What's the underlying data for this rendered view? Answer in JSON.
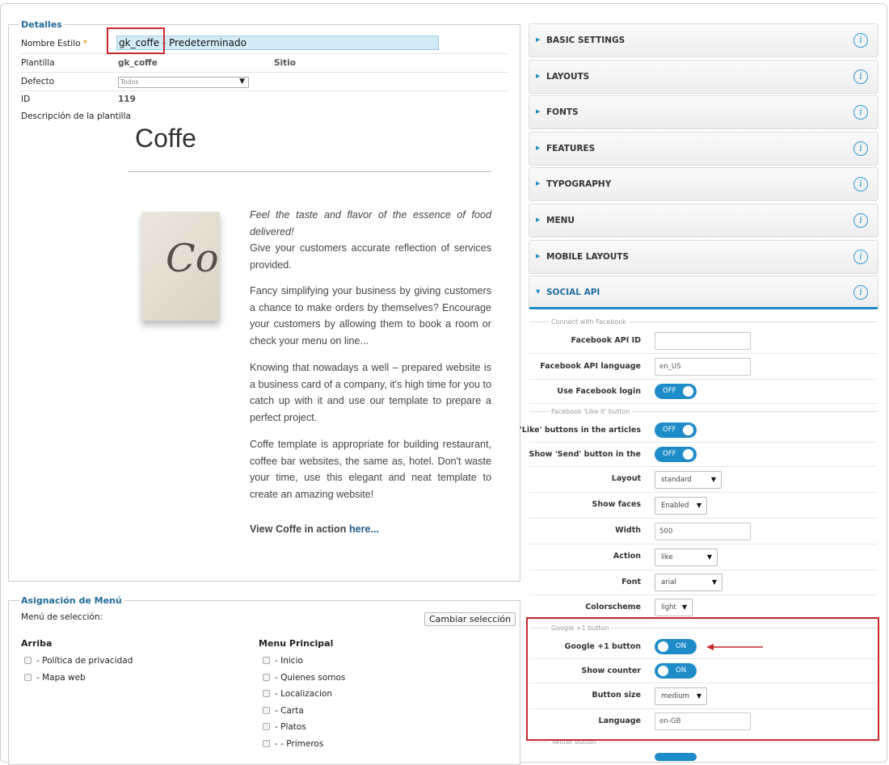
{
  "details": {
    "legend": "Detalles",
    "style_name_label": "Nombre Estilo",
    "required_mark": "*",
    "style_name_value": "gk_coffe - Predeterminado",
    "template_label": "Plantilla",
    "template_value": "gk_coffe",
    "site_label": "Sitio",
    "default_label": "Defecto",
    "default_value": "Todos",
    "id_label": "ID",
    "id_value": "119",
    "description_label": "Descripción de la plantilla"
  },
  "preview": {
    "title": "Coffe",
    "image_text": "Co",
    "p1_italic": "Feel the taste and flavor of the essence of food delivered!",
    "p1_rest": "Give your customers accurate reflection of services provided.",
    "p2": "Fancy simplifying your business by giving customers a chance to make orders by themselves? Encourage your customers by allowing them to book a room or check your menu on line...",
    "p3": "Knowing that nowadays a well – prepared website is a business card of a company, it's high time for you to catch up with it and use our template to prepare a perfect project.",
    "p4": "Coffe template is appropriate for building restaurant, coffee bar websites, the same as, hotel. Don't waste your time, use this elegant and neat template to create an amazing website!",
    "cta_text": "View Coffe in action",
    "cta_link": "here..."
  },
  "menu_assign": {
    "legend": "Asignación de Menú",
    "selection_label": "Menú de selección:",
    "change_button": "Cambiar selección",
    "col1_title": "Arriba",
    "col1_items": [
      "- Política de privacidad",
      "- Mapa web"
    ],
    "col2_title": "Menu Principal",
    "col2_items": [
      "- Inicio",
      "- Quienes somos",
      "- Localizacion",
      "- Carta",
      "- Platos",
      "- - Primeros"
    ]
  },
  "panels": [
    "BASIC SETTINGS",
    "LAYOUTS",
    "FONTS",
    "FEATURES",
    "TYPOGRAPHY",
    "MENU",
    "MOBILE LAYOUTS",
    "SOCIAL API"
  ],
  "info_glyph": "i",
  "social": {
    "sect_facebook": "Connect with Facebook",
    "fb_api_id_label": "Facebook API ID",
    "fb_api_id_value": "",
    "fb_lang_label": "Facebook API language",
    "fb_lang_value": "en_US",
    "fb_login_label": "Use Facebook login",
    "fb_login_state": "OFF",
    "sect_like": "Facebook 'Like it' button",
    "like_articles_label": "'Like' buttons in the articles",
    "like_articles_state": "OFF",
    "send_label": "Show 'Send' button in the",
    "send_state": "OFF",
    "layout_label": "Layout",
    "layout_value": "standard",
    "faces_label": "Show faces",
    "faces_value": "Enabled",
    "width_label": "Width",
    "width_value": "500",
    "action_label": "Action",
    "action_value": "like",
    "font_label": "Font",
    "font_value": "arial",
    "scheme_label": "Colorscheme",
    "scheme_value": "light",
    "sect_google": "Google +1 button",
    "gplus_label": "Google +1 button",
    "gplus_state": "ON",
    "counter_label": "Show counter",
    "counter_state": "ON",
    "size_label": "Button size",
    "size_value": "medium",
    "lang_label": "Language",
    "lang_value": "en-GB",
    "sect_twitter": "Twitter button"
  },
  "colors": {
    "accent": "#1e8cc8",
    "highlight": "#c8282d",
    "legend": "#1f6a9a"
  }
}
